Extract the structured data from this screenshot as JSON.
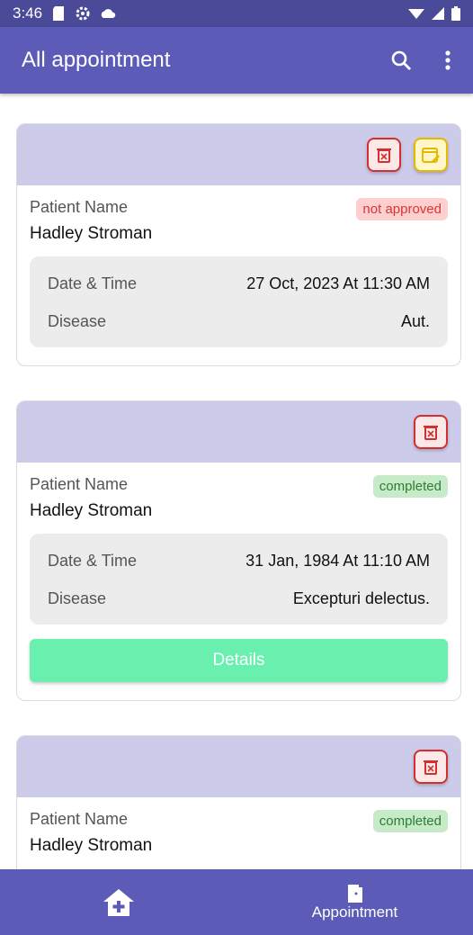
{
  "status_bar": {
    "time": "3:46"
  },
  "app_bar": {
    "title": "All appointment"
  },
  "labels": {
    "patient_name": "Patient Name",
    "date_time": "Date & Time",
    "disease": "Disease",
    "details": "Details"
  },
  "appointments": [
    {
      "patient": "Hadley Stroman",
      "status": "not approved",
      "datetime": "27 Oct, 2023 At 11:30 AM",
      "disease": "Aut."
    },
    {
      "patient": "Hadley Stroman",
      "status": "completed",
      "datetime": "31 Jan, 1984 At 11:10 AM",
      "disease": "Excepturi delectus."
    },
    {
      "patient": "Hadley Stroman",
      "status": "completed"
    }
  ],
  "bottom_nav": {
    "appointment_label": "Appointment"
  },
  "colors": {
    "primary": "#5c5cb8",
    "card_header": "#cccbea",
    "details_button": "#69f0ae",
    "delete": "#d32f2f",
    "edit": "#e6b800"
  }
}
